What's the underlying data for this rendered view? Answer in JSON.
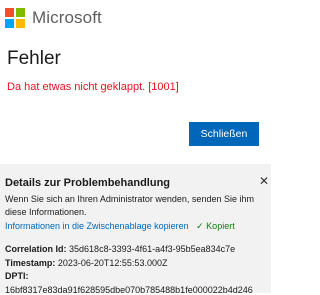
{
  "brand": {
    "name": "Microsoft",
    "logo_colors": [
      "#f25022",
      "#7fba00",
      "#00a4ef",
      "#ffb900"
    ]
  },
  "title": "Fehler",
  "error_message": "Da hat etwas nicht geklappt. [1001]",
  "close_button_label": "Schließen",
  "colors": {
    "error": "#e81123",
    "accent": "#0067b8",
    "success": "#107c10"
  },
  "details": {
    "close_icon": "close-icon",
    "title": "Details zur Problembehandlung",
    "text": "Wenn Sie sich an Ihren Administrator wenden, senden Sie ihm diese Informationen.",
    "copy_link": "Informationen in die Zwischenablage kopieren",
    "copied_label": "✓ Kopiert",
    "fields": [
      {
        "label": "Correlation Id:",
        "value": "35d618c8-3393-4f61-a4f3-95b5ea834c7e"
      },
      {
        "label": "Timestamp:",
        "value": "2023-06-20T12:55:53.000Z"
      },
      {
        "label": "DPTI:",
        "value": ""
      }
    ],
    "dpti_value": "16bf8317e83da91f628595dbe070b785488b1fe000022b4d246"
  }
}
